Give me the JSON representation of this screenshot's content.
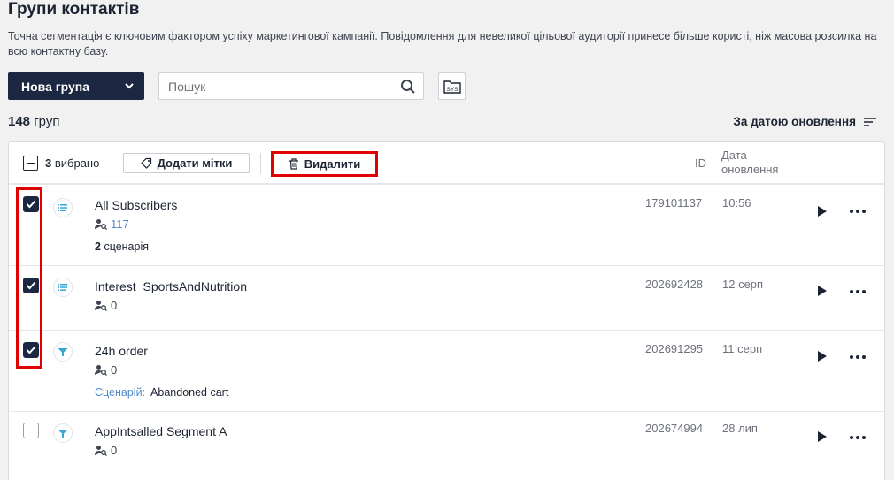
{
  "header": {
    "title": "Групи контактів",
    "description": "Точна сегментація є ключовим фактором успіху маркетингової кампанії. Повідомлення для невеликої цільової аудиторії принесе більше користі, ніж масова розсилка на всю контактну базу."
  },
  "toolbar": {
    "new_group_label": "Нова група",
    "search_placeholder": "Пошук",
    "sys_label": "SYS"
  },
  "summary": {
    "count": "148",
    "count_suffix": "груп",
    "sort_label": "За датою оновлення"
  },
  "bulk_bar": {
    "selected_count": "3",
    "selected_label": "вибрано",
    "add_tags_label": "Додати мітки",
    "delete_label": "Видалити",
    "col_id": "ID",
    "col_date_line1": "Дата",
    "col_date_line2": "оновлення"
  },
  "rows": [
    {
      "name": "All Subscribers",
      "count": "117",
      "extra_bold": "2",
      "extra_text": "сценарія",
      "id": "179101137",
      "date": "10:56",
      "checked": true,
      "icon": "list-icon"
    },
    {
      "name": "Interest_SportsAndNutrition",
      "count": "0",
      "id": "202692428",
      "date": "12 серп",
      "checked": true,
      "icon": "list-icon"
    },
    {
      "name": "24h order",
      "count": "0",
      "extra_label": "Сценарій:",
      "extra_text": "Abandoned cart",
      "id": "202691295",
      "date": "11 серп",
      "checked": true,
      "icon": "filter-icon"
    },
    {
      "name": "AppIntsalled Segment A",
      "count": "0",
      "id": "202674994",
      "date": "28 лип",
      "checked": false,
      "icon": "filter-icon"
    }
  ],
  "colors": {
    "accent": "#1c2742",
    "highlight": "#e00000",
    "link": "#4f8bc9"
  }
}
